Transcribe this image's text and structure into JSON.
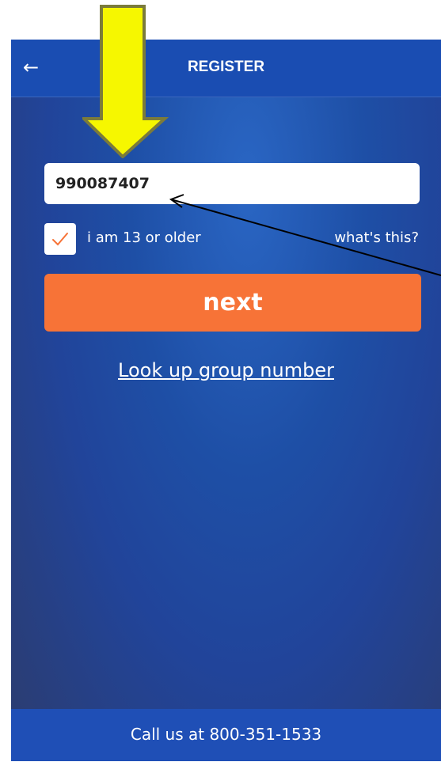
{
  "header": {
    "title": "REGISTER",
    "back_icon": "back-arrow-icon"
  },
  "form": {
    "group_number_value": "990087407",
    "age_checkbox": {
      "label": "i am 13 or older",
      "checked": true,
      "icon": "checkmark-icon"
    },
    "whats_this_link": "what's this?",
    "next_button": "next",
    "lookup_link": "Look up group number"
  },
  "footer": {
    "call_text": "Call us at 800-351-1533"
  },
  "annotations": {
    "yellow_arrow_icon": "down-arrow-icon",
    "pointer_arrow_icon": "pointer-arrow-icon"
  },
  "colors": {
    "header_bg": "#1a4db2",
    "footer_bg": "#1f4fb6",
    "next_button_bg": "#f77337",
    "checkmark": "#f77337",
    "annotation_arrow": "#f6f700"
  }
}
